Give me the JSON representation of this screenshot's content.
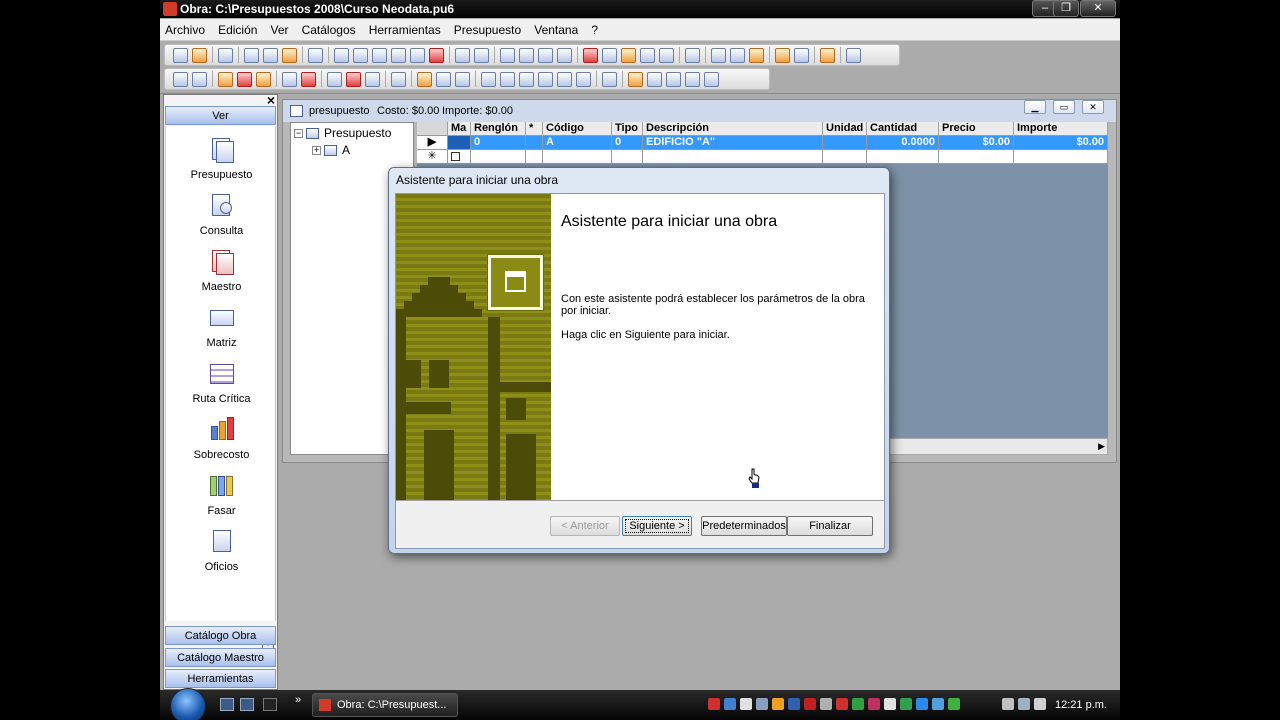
{
  "window": {
    "title": "Obra: C:\\Presupuestos 2008\\Curso Neodata.pu6",
    "minimize": "–",
    "maximize": "❐",
    "close": "✕"
  },
  "menu": [
    "Archivo",
    "Edición",
    "Ver",
    "Catálogos",
    "Herramientas",
    "Presupuesto",
    "Ventana",
    "?"
  ],
  "nav": {
    "close": "×",
    "header": "Ver",
    "items": [
      "Presupuesto",
      "Consulta",
      "Maestro",
      "Matriz",
      "Ruta Crítica",
      "Sobrecosto",
      "Fasar",
      "Oficios"
    ],
    "footer": [
      "Catálogo Obra",
      "Catálogo Maestro",
      "Herramientas"
    ]
  },
  "child": {
    "name": "presupuesto",
    "costo": "Costo: $0.00",
    "importe": "Importe: $0.00",
    "tree": {
      "root": "Presupuesto",
      "child": "A"
    },
    "grid": {
      "headers": [
        "Ma",
        "Renglón",
        "*",
        "Código",
        "Tipo",
        "Descripción",
        "Unidad",
        "Cantidad",
        "Precio",
        "Importe"
      ],
      "row": {
        "renglon": "0",
        "codigo": "A",
        "tipo": "0",
        "descripcion": "EDIFICIO \"A\"",
        "cantidad": "0.0000",
        "precio": "$0.00",
        "importe": "$0.00"
      },
      "new_row_marker": "✳",
      "current_row_marker": "▶"
    }
  },
  "dialog": {
    "title": "Asistente para iniciar una obra",
    "heading": "Asistente para iniciar una obra",
    "paragraph1": "Con este asistente podrá establecer los parámetros de la obra por iniciar.",
    "paragraph2": "Haga clic en Siguiente para iniciar.",
    "buttons": {
      "back": "< Anterior",
      "next": "Siguiente >",
      "defaults": "Predeterminados",
      "finish": "Finalizar"
    }
  },
  "taskbar": {
    "task": "Obra: C:\\Presupuest...",
    "chevron": "»",
    "clock": "12:21 p.m."
  }
}
